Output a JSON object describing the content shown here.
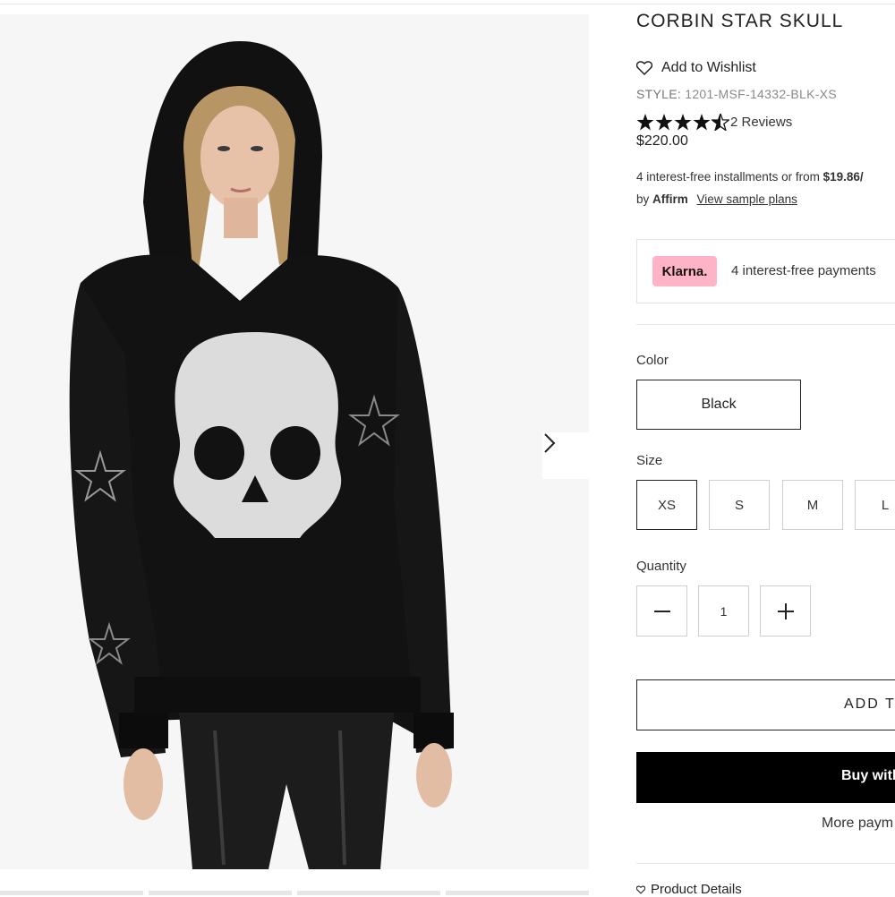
{
  "product": {
    "title": "CORBIN STAR SKULL",
    "wishlist_label": "Add to Wishlist",
    "style_prefix": "STYLE:",
    "style_code": "1201-MSF-14332-BLK-XS",
    "rating": 4.5,
    "reviews_label": "2 Reviews",
    "price": "$220.00"
  },
  "affirm": {
    "line1_text": "4 interest-free installments or from",
    "amount": "$19.86/",
    "by_text": "by",
    "brand": "Affirm",
    "link_label": "View sample plans"
  },
  "klarna": {
    "badge": "Klarna.",
    "text": "4 interest-free payments"
  },
  "color": {
    "label": "Color",
    "selected": "Black"
  },
  "size": {
    "label": "Size",
    "options": [
      "XS",
      "S",
      "M",
      "L"
    ],
    "selected": "XS"
  },
  "quantity": {
    "label": "Quantity",
    "value": "1"
  },
  "actions": {
    "add_to_cart": "ADD TO",
    "buy_with": "Buy with",
    "more_payment": "More paym"
  },
  "details_label": "Product Details",
  "colors": {
    "klarna_pink": "#ffb3c7",
    "buy_button": "#000000",
    "text": "#1a1a1a"
  }
}
